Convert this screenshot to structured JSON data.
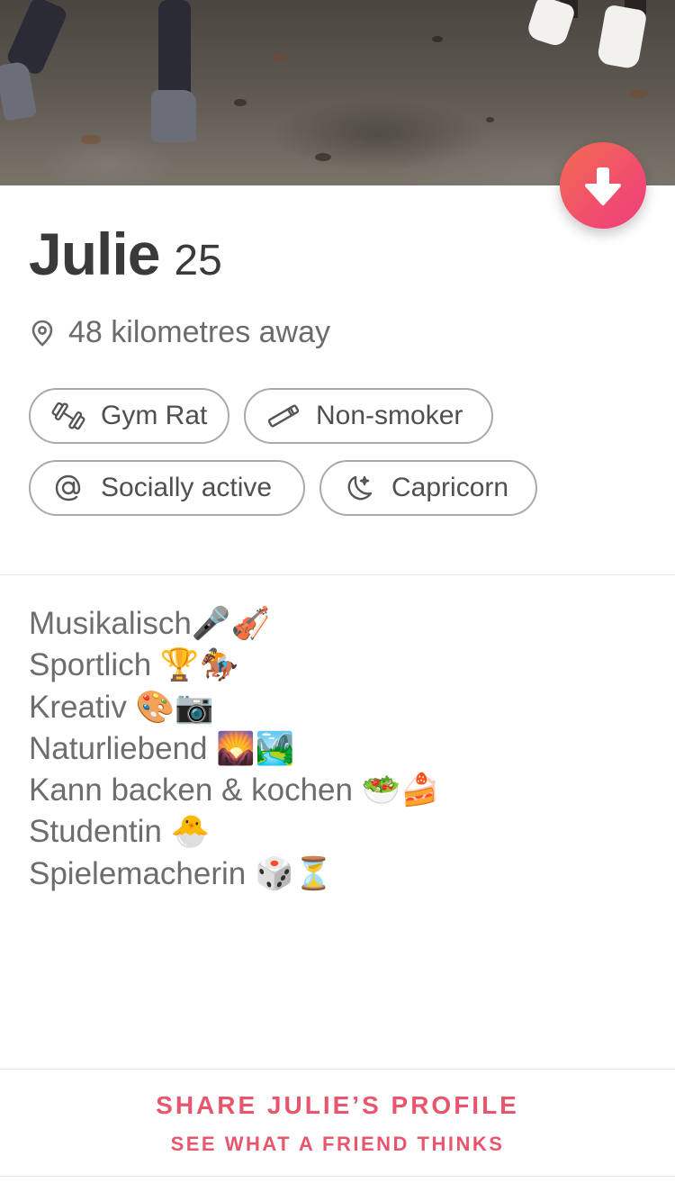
{
  "profile": {
    "name": "Julie",
    "age": "25",
    "distance": "48 kilometres away"
  },
  "chips": [
    {
      "label": "Gym Rat",
      "icon": "dumbbell-icon"
    },
    {
      "label": "Non-smoker",
      "icon": "cigarette-icon"
    },
    {
      "label": "Socially active",
      "icon": "at-sign-icon"
    },
    {
      "label": "Capricorn",
      "icon": "moon-stars-icon"
    }
  ],
  "bio": [
    "Musikalisch🎤🎻",
    "Sportlich 🏆🏇",
    "Kreativ  🎨📷",
    "Naturliebend 🌄🏞️",
    "Kann  backen & kochen 🥗🍰",
    "Studentin  🐣",
    "Spielemacherin 🎲⏳"
  ],
  "share": {
    "title": "SHARE JULIE’S PROFILE",
    "subtitle": "SEE WHAT A FRIEND THINKS"
  },
  "colors": {
    "accent": "#e8566e",
    "button_gradient_start": "#f56b52",
    "button_gradient_end": "#ee3e7c"
  }
}
